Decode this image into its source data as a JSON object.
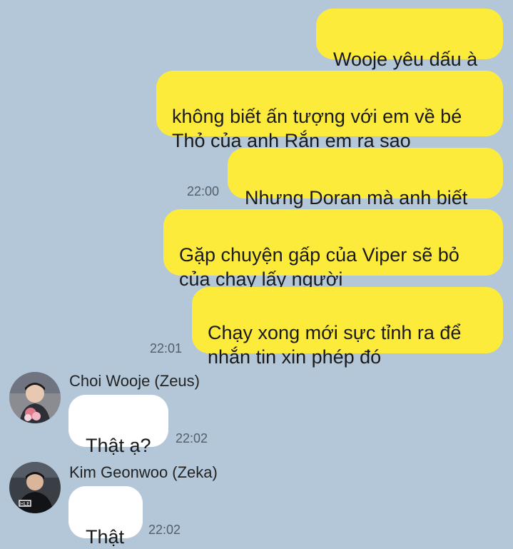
{
  "theme": {
    "background": "#b3c7d9",
    "outgoing_bubble": "#fdeb3c",
    "incoming_bubble": "#ffffff",
    "timestamp_color": "#555e68"
  },
  "messages": {
    "m1": {
      "text": "Wooje yêu dấu à"
    },
    "m2": {
      "text": "không biết ấn tượng với em về bé\nThỏ của anh Rắn em ra sao"
    },
    "m3": {
      "text": "Nhưng Doran mà anh biết",
      "time": "22:00"
    },
    "m4": {
      "text": "Gặp chuyện gấp của Viper sẽ bỏ\ncủa chạy lấy người"
    },
    "m5": {
      "text": "Chạy xong mới sực tỉnh ra để\nnhắn tin xin phép đó",
      "time": "22:01"
    },
    "m6": {
      "sender": "Choi Wooje (Zeus)",
      "avatar_icon": "user-avatar-zeus",
      "text": "Thật ạ?",
      "time": "22:02"
    },
    "m7": {
      "sender": "Kim Geonwoo (Zeka)",
      "avatar_icon": "user-avatar-zeka",
      "text": "Thật",
      "time": "22:02"
    }
  }
}
